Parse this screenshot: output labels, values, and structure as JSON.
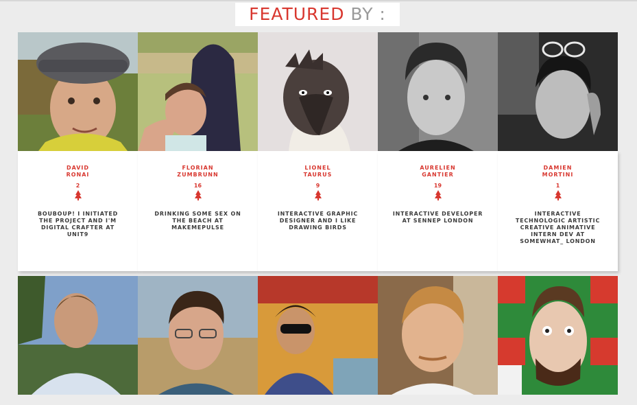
{
  "header": {
    "title_part1": "FEATURED",
    "title_part2": "BY :"
  },
  "colors": {
    "accent": "#d8372f",
    "muted": "#9a9a9a",
    "text": "#3a3a3a"
  },
  "contributors_row1": [
    {
      "name": "DAVID\nRONAI",
      "count": "2",
      "description": "BOUBOUP! I INITIATED THE PROJECT AND I'M DIGITAL CRAFTER AT UNIT9"
    },
    {
      "name": "FLORIAN\nZUMBRUNN",
      "count": "16",
      "description": "DRINKING SOME SEX ON THE BEACH AT MAKEMEPULSE"
    },
    {
      "name": "LIONEL\nTAURUS",
      "count": "9",
      "description": "INTERACTIVE GRAPHIC DESIGNER AND I LIKE DRAWING BIRDS"
    },
    {
      "name": "AURELIEN\nGANTIER",
      "count": "19",
      "description": "INTERACTIVE DEVELOPER AT SENNEP LONDON"
    },
    {
      "name": "DAMIEN\nMORTINI",
      "count": "1",
      "description": "INTERACTIVE TECHNOLOGIC ARTISTIC CREATIVE ANIMATIVE INTERN DEV AT SOMEWHAT_ LONDON"
    }
  ],
  "icons": {
    "separator": "tree-icon"
  }
}
